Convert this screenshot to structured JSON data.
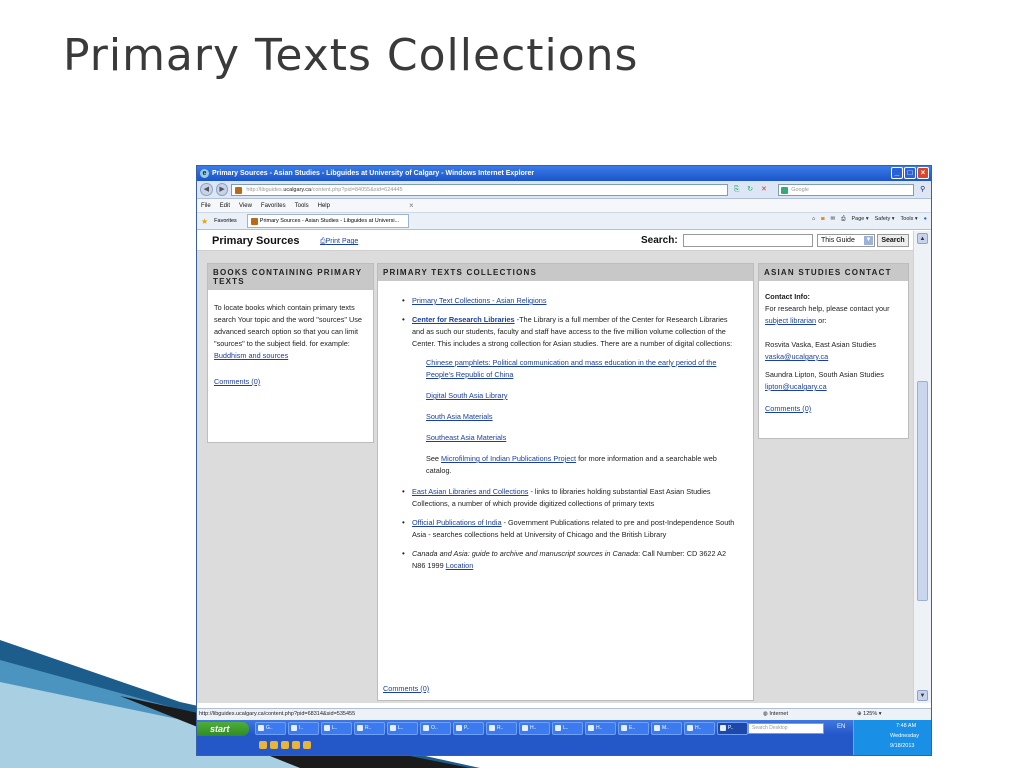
{
  "slide": {
    "title": "Primary Texts Collections"
  },
  "window": {
    "title": "Primary Sources - Asian Studies - Libguides at University of Calgary - Windows Internet Explorer",
    "url_prefix": "http://libguides.",
    "url_domain": "ucalgary.ca",
    "url_rest": "/content.php?pid=84055&sid=624445",
    "search_engine": "Google",
    "menu": [
      "File",
      "Edit",
      "View",
      "Favorites",
      "Tools",
      "Help"
    ],
    "favorites_label": "Favorites",
    "tab_title": "Primary Sources - Asian Studies - Libguides at Universi...",
    "commands": [
      "Page ▾",
      "Safety ▾",
      "Tools ▾"
    ],
    "status_url": "http://libguides.ucalgary.ca/content.php?pid=68314&sid=535455",
    "status_zone": "Internet",
    "zoom": "125%"
  },
  "page": {
    "title": "Primary Sources",
    "print_label": "Print Page",
    "search_label": "Search:",
    "search_scope": "This Guide",
    "search_button": "Search",
    "left_box": {
      "header": "BOOKS CONTAINING PRIMARY TEXTS",
      "text": "To locate books which contain primary texts search Your topic and the word \"sources\" Use advanced search option so that you can limit \"sources\" to the subject field.   for example:",
      "example_link": "Buddhism and sources",
      "comments": "Comments (0)"
    },
    "middle_box": {
      "header": "PRIMARY TEXTS COLLECTIONS",
      "item1_link": "Primary Text Collections - Asian Religions",
      "item2_link": "Center for Research Libraries",
      "item2_text": " -The Library is a full member of the Center for Research Libraries and as such our students, faculty and staff have access to the five million volume collection of the Center. This includes a strong collection for Asian studies.  There are a number of digital collections:",
      "sub1": "Chinese pamphlets: Political communication and mass education in the early period of the People's Republic of China",
      "sub2": "Digital South Asia Library",
      "sub3": "South Asia Materials",
      "sub4": "Southeast Asia Materials",
      "sub5_pre": "See ",
      "sub5_link": "Microfilming of Indian Publications Project",
      "sub5_post": " for more information and a searchable web catalog.",
      "item3_link": "East Asian Libraries and Collections",
      "item3_text": " -  links to libraries holding substantial East Asian Studies Collections, a number of which provide digitized collections of primary texts",
      "item4_link": "Official Publications of India",
      "item4_text": "  -  Government Publications related to pre and post-Independence South Asia - searches collections held at University of Chicago and the British Library",
      "item5_italic": "Canada and Asia: guide to archive and manuscript sources in Canada",
      "item5_text": ": Call Number: CD 3622 A2 N86 1999  ",
      "item5_link": "Location",
      "comments": "Comments (0)"
    },
    "right_box": {
      "header": "ASIAN STUDIES CONTACT",
      "contact_label": "Contact Info:",
      "contact_text": "For research help, please contact your",
      "librarian_link": " subject librarian",
      "or": " or:",
      "person1": "Rosvita Vaska, East Asian Studies",
      "email1": "vaska@ucalgary.ca",
      "person2": "Saundra Lipton, South Asian Studies",
      "email2": "lipton@ucalgary.ca",
      "comments": "Comments (0)"
    }
  },
  "taskbar": {
    "start": "start",
    "tasks": [
      "G..",
      "I..",
      "L..",
      "R..",
      "L..",
      "O..",
      "P..",
      "R..",
      "H..",
      "L..",
      "H..",
      "E..",
      "M..",
      "H..",
      "P.."
    ],
    "desktop_search": "Search Desktop",
    "lang": "EN",
    "time": "7:48 AM",
    "day": "Wednesday",
    "date": "9/18/2013"
  },
  "colors": {
    "link": "#1a3fa6",
    "titlebar": "#1a54c9",
    "header_gray": "#c8c8c8",
    "taskbar": "#2457c8"
  }
}
